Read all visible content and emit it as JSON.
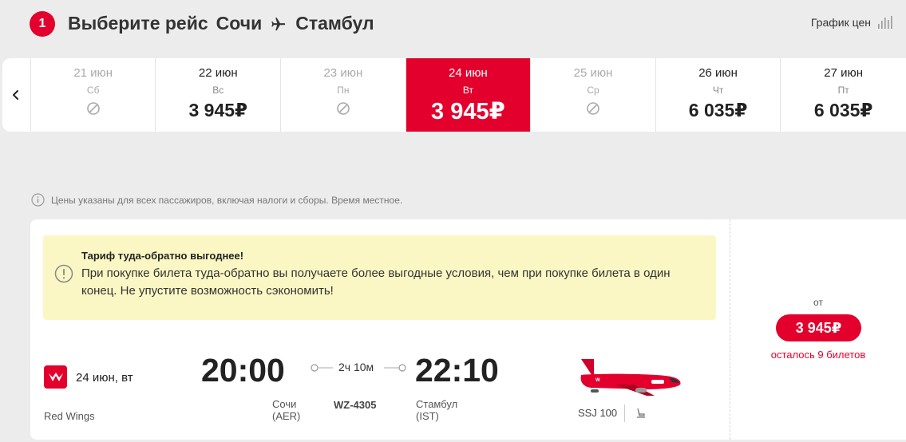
{
  "header": {
    "step": "1",
    "title_prefix": "Выберите рейс",
    "origin": "Сочи",
    "destination": "Стамбул",
    "price_chart_label": "График цен"
  },
  "dates": [
    {
      "date": "21 июн",
      "dow": "Сб",
      "price": null,
      "available": false
    },
    {
      "date": "22 июн",
      "dow": "Вс",
      "price": "3 945₽",
      "available": true
    },
    {
      "date": "23 июн",
      "dow": "Пн",
      "price": null,
      "available": false
    },
    {
      "date": "24 июн",
      "dow": "Вт",
      "price": "3 945₽",
      "available": true,
      "selected": true
    },
    {
      "date": "25 июн",
      "dow": "Ср",
      "price": null,
      "available": false
    },
    {
      "date": "26 июн",
      "dow": "Чт",
      "price": "6 035₽",
      "available": true
    },
    {
      "date": "27 июн",
      "dow": "Пт",
      "price": "6 035₽",
      "available": true
    }
  ],
  "note": "Цены указаны для всех пассажиров, включая налоги и сборы. Время местное.",
  "promo": {
    "title": "Тариф туда-обратно выгоднее!",
    "text": "При покупке билета туда-обратно вы получаете более выгодные условия, чем при покупке билета в один конец. Не упустите возможность сэкономить!"
  },
  "flight": {
    "date": "24 июн, вт",
    "airline": "Red Wings",
    "departure_time": "20:00",
    "departure_city": "Сочи",
    "departure_code": "(AER)",
    "arrival_time": "22:10",
    "arrival_city": "Стамбул",
    "arrival_code": "(IST)",
    "duration": "2ч 10м",
    "flight_number": "WZ-4305",
    "aircraft": "SSJ 100"
  },
  "offer": {
    "from_label": "от",
    "price": "3 945₽",
    "seats_left": "осталось 9 билетов"
  },
  "colors": {
    "accent": "#e3002d",
    "promo_bg": "#fbf7c4",
    "page_bg": "#ececec"
  }
}
